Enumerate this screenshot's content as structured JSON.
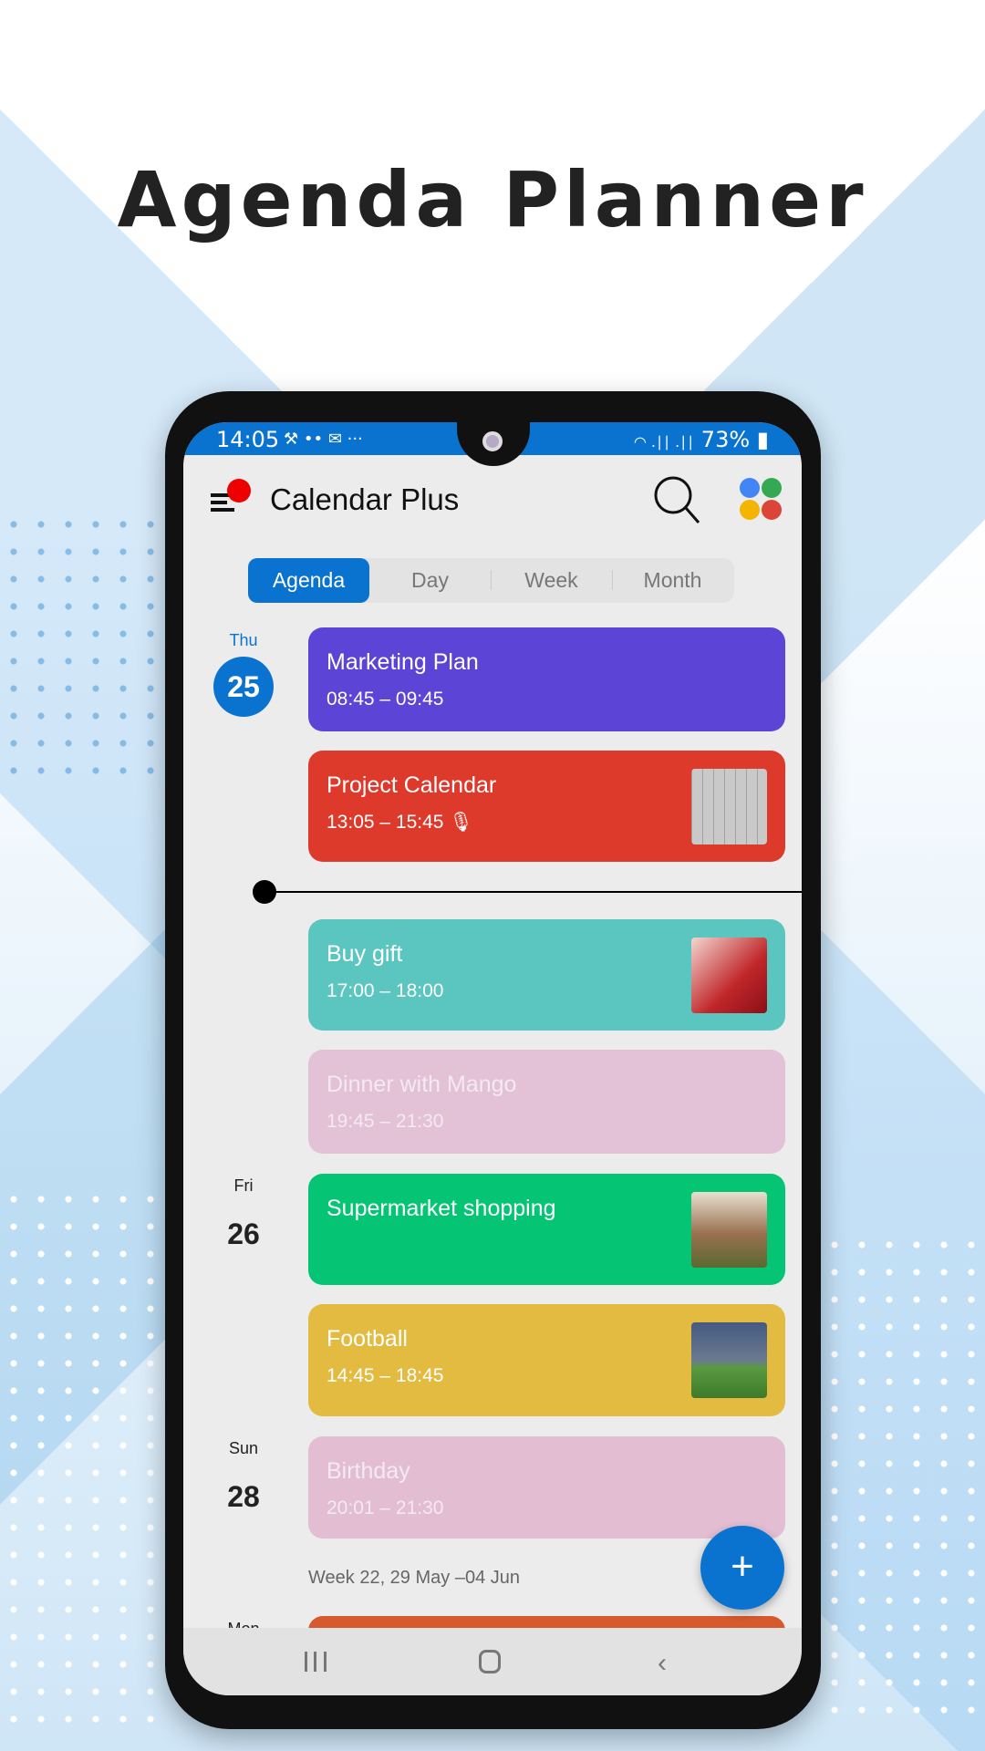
{
  "page_title": "Agenda Planner",
  "status_bar": {
    "time": "14:05",
    "icons_left": "⚒ •• ✉ ···",
    "signal": "◠ .∣∣ .∣∣",
    "battery": "73%"
  },
  "header": {
    "app_title": "Calendar Plus"
  },
  "tabs": [
    {
      "label": "Agenda",
      "active": true
    },
    {
      "label": "Day"
    },
    {
      "label": "Week"
    },
    {
      "label": "Month"
    }
  ],
  "days": [
    {
      "weekday": "Thu",
      "day": "25",
      "today": true
    },
    {
      "weekday": "Fri",
      "day": "26"
    },
    {
      "weekday": "Sun",
      "day": "28"
    },
    {
      "weekday": "Mon"
    }
  ],
  "events": [
    {
      "title": "Marketing Plan",
      "time": "08:45 – 09:45",
      "color": "#5b44d6"
    },
    {
      "title": "Project Calendar",
      "time": "13:05 – 15:45",
      "color": "#dd3a2c",
      "has_voice_note": true,
      "thumbnail": "whiteboard-calendar"
    },
    {
      "title": "Buy gift",
      "time": "17:00 – 18:00",
      "color": "#5bc5c0",
      "thumbnail": "gift-box-roses"
    },
    {
      "title": "Dinner with Mango",
      "time": "19:45 – 21:30",
      "color": "#e3c1d6",
      "faded": true
    },
    {
      "title": "Supermarket shopping",
      "time": "",
      "color": "#05c474",
      "thumbnail": "grocery-store"
    },
    {
      "title": "Football",
      "time": "14:45 – 18:45",
      "color": "#e2bb40",
      "thumbnail": "soccer-players"
    },
    {
      "title": "Birthday",
      "time": "20:01 – 21:30",
      "color": "#e3bdd2",
      "faded": true
    }
  ],
  "week_separator": "Week 22, 29 May  –04 Jun",
  "colors": {
    "accent": "#0a73d0",
    "next_event": "#d65a2e"
  }
}
